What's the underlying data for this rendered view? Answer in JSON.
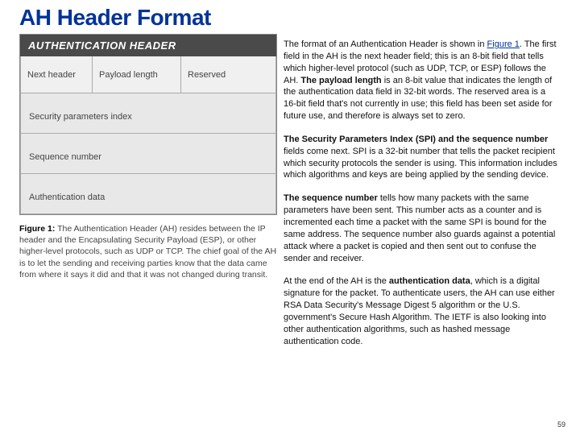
{
  "title": "AH Header Format",
  "diagram": {
    "header": "AUTHENTICATION HEADER",
    "row1": {
      "next_header": "Next header",
      "payload_length": "Payload length",
      "reserved": "Reserved"
    },
    "spi": "Security parameters index",
    "seq": "Sequence number",
    "auth": "Authentication data"
  },
  "caption": {
    "label": "Figure 1:",
    "text": "The Authentication Header (AH) resides between the IP header and the Encapsulating Security Payload (ESP), or other higher-level protocols, such as UDP or TCP. The chief goal of the AH is to let the sending and receiving parties know that the data came from where it says it did and that it was not changed during transit."
  },
  "paragraphs": {
    "p1_a": "The format of an Authentication Header is shown in ",
    "p1_link": "Figure 1",
    "p1_b": ". The first field in the AH is the next header field; this is an 8-bit field that tells which higher-level protocol (such as UDP, TCP, or ESP) follows the AH. ",
    "p1_bold": "The payload length",
    "p1_c": " is an 8-bit value that indicates the length of the authentication data field in 32-bit words. The reserved area is a 16-bit field that's not currently in use; this field has been set aside for future use, and therefore is always set to zero.",
    "p2_bold": "The Security Parameters Index (SPI) and the sequence number",
    "p2_rest": " fields come next. SPI is a 32-bit number that tells the packet recipient which security protocols the sender is using. This information includes which algorithms and keys are being applied by the sending device.",
    "p3_bold": "The sequence number",
    "p3_rest": " tells how many packets with the same parameters have been sent. This number acts as a counter and is incremented each time a packet with the same SPI is bound for the same address. The sequence number also guards against a potential attack where a packet is copied and then sent out to confuse the sender and receiver.",
    "p4_a": "At the end of the AH is the ",
    "p4_bold": "authentication data",
    "p4_b": ", which is a digital signature for the packet. To authenticate users, the AH can use either RSA Data Security's Message Digest 5 algorithm or the U.S. government's Secure Hash Algorithm. The IETF is also looking into other authentication algorithms, such as hashed message authentication code."
  },
  "page_number": "59"
}
